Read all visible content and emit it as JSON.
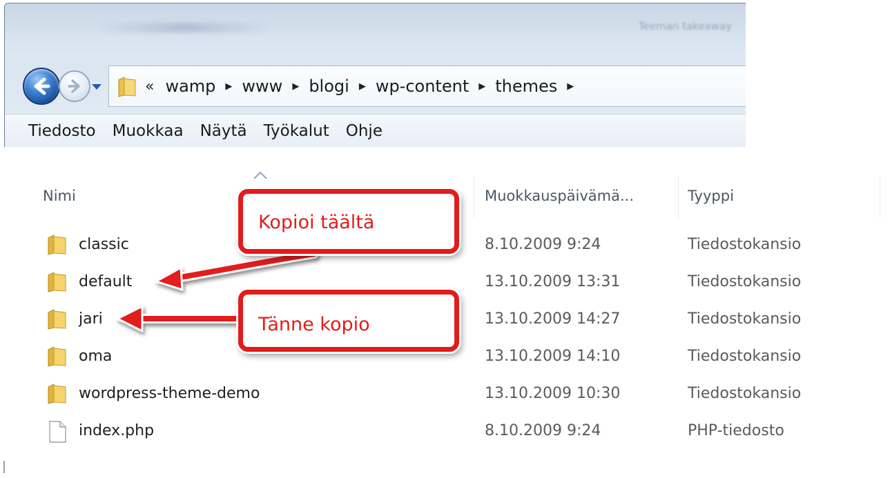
{
  "window": {
    "title": "Teeman takeaway"
  },
  "navigation": {
    "overflow_glyph": "«",
    "breadcrumbs": [
      "wamp",
      "www",
      "blogi",
      "wp-content",
      "themes"
    ]
  },
  "menu": {
    "items": [
      "Tiedosto",
      "Muokkaa",
      "Näytä",
      "Työkalut",
      "Ohje"
    ]
  },
  "columns": {
    "name": "Nimi",
    "modified": "Muokkauspäivämä...",
    "type": "Tyyppi"
  },
  "files": [
    {
      "name": "classic",
      "modified": "8.10.2009 9:24",
      "type": "Tiedostokansio",
      "icon": "folder-icon"
    },
    {
      "name": "default",
      "modified": "13.10.2009 13:31",
      "type": "Tiedostokansio",
      "icon": "folder-icon"
    },
    {
      "name": "jari",
      "modified": "13.10.2009 14:27",
      "type": "Tiedostokansio",
      "icon": "folder-icon"
    },
    {
      "name": "oma",
      "modified": "13.10.2009 14:10",
      "type": "Tiedostokansio",
      "icon": "folder-icon"
    },
    {
      "name": "wordpress-theme-demo",
      "modified": "13.10.2009 10:30",
      "type": "Tiedostokansio",
      "icon": "folder-icon"
    },
    {
      "name": "index.php",
      "modified": "8.10.2009 9:24",
      "type": "PHP-tiedosto",
      "icon": "file-icon"
    }
  ],
  "annotations": {
    "copy_from": "Kopioi täältä",
    "copy_to": "Tänne kopio",
    "color": "#e31b1b"
  }
}
